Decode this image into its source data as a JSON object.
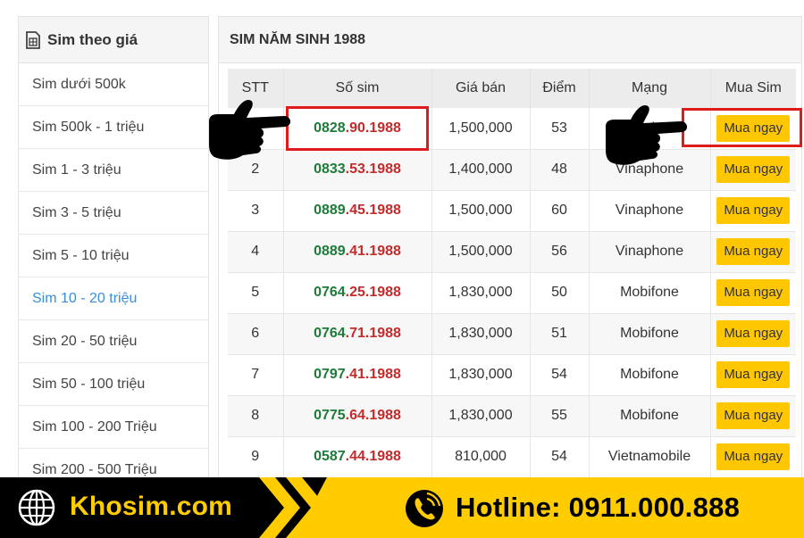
{
  "sidebar": {
    "title": "Sim theo giá",
    "items": [
      {
        "label": "Sim dưới 500k",
        "active": false
      },
      {
        "label": "Sim 500k - 1 triệu",
        "active": false
      },
      {
        "label": "Sim 1 - 3 triệu",
        "active": false
      },
      {
        "label": "Sim 3 - 5 triệu",
        "active": false
      },
      {
        "label": "Sim 5 - 10 triệu",
        "active": false
      },
      {
        "label": "Sim 10 - 20 triệu",
        "active": true
      },
      {
        "label": "Sim 20 - 50 triệu",
        "active": false
      },
      {
        "label": "Sim 50 - 100 triệu",
        "active": false
      },
      {
        "label": "Sim 100 - 200 Triệu",
        "active": false
      },
      {
        "label": "Sim 200 - 500 Triệu",
        "active": false
      }
    ]
  },
  "main": {
    "title": "SIM NĂM SINH 1988",
    "columns": [
      "STT",
      "Số sim",
      "Giá bán",
      "Điểm",
      "Mạng",
      "Mua Sim"
    ],
    "buy_label": "Mua ngay",
    "rows": [
      {
        "stt": "1",
        "prefix": "0828",
        "suffix": ".90.1988",
        "price": "1,500,000",
        "score": "53",
        "network": "Vinaphone",
        "net_class": "net-vina"
      },
      {
        "stt": "2",
        "prefix": "0833",
        "suffix": ".53.1988",
        "price": "1,400,000",
        "score": "48",
        "network": "Vinaphone",
        "net_class": "net-vina"
      },
      {
        "stt": "3",
        "prefix": "0889",
        "suffix": ".45.1988",
        "price": "1,500,000",
        "score": "60",
        "network": "Vinaphone",
        "net_class": "net-vina"
      },
      {
        "stt": "4",
        "prefix": "0889",
        "suffix": ".41.1988",
        "price": "1,500,000",
        "score": "56",
        "network": "Vinaphone",
        "net_class": "net-vina"
      },
      {
        "stt": "5",
        "prefix": "0764",
        "suffix": ".25.1988",
        "price": "1,830,000",
        "score": "50",
        "network": "Mobifone",
        "net_class": "net-mobi"
      },
      {
        "stt": "6",
        "prefix": "0764",
        "suffix": ".71.1988",
        "price": "1,830,000",
        "score": "51",
        "network": "Mobifone",
        "net_class": "net-mobi"
      },
      {
        "stt": "7",
        "prefix": "0797",
        "suffix": ".41.1988",
        "price": "1,830,000",
        "score": "54",
        "network": "Mobifone",
        "net_class": "net-mobi"
      },
      {
        "stt": "8",
        "prefix": "0775",
        "suffix": ".64.1988",
        "price": "1,830,000",
        "score": "55",
        "network": "Mobifone",
        "net_class": "net-mobi"
      },
      {
        "stt": "9",
        "prefix": "0587",
        "suffix": ".44.1988",
        "price": "810,000",
        "score": "54",
        "network": "Vietnamobile",
        "net_class": "net-vmb"
      }
    ]
  },
  "banner": {
    "brand": "Khosim.com",
    "hotline": "Hotline: 0911.000.888"
  },
  "colors": {
    "accent_yellow": "#ffcc00",
    "button_yellow": "#ffc700",
    "number_green": "#1e7b3a",
    "number_red": "#c62b2b",
    "highlight_red": "#e01b1b",
    "active_link": "#3a8fd9"
  },
  "icons": [
    "sim-card-icon",
    "pointing-hand-icon",
    "globe-icon",
    "phone-call-icon",
    "chevron-right-icon"
  ]
}
